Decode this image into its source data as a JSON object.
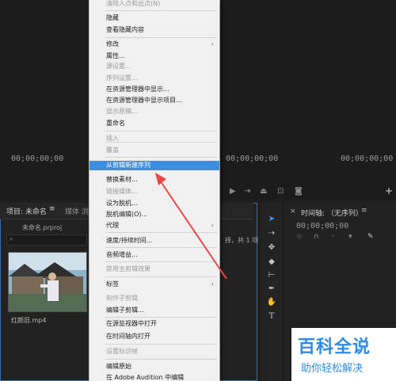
{
  "source_monitor": {
    "timecode": "00;00;00;00"
  },
  "program_monitor": {
    "timecode_left": "00;00;00;00",
    "timecode_right": "00;00;00;00"
  },
  "project_panel": {
    "tab_title": "项目: 未命名",
    "tab_menu": "≡",
    "tab2": "媒体 浏",
    "project_file": "未命名.prproj",
    "clip_name": "红颜旧.mp4",
    "item_count": "择，共 1 项"
  },
  "timeline_panel": {
    "title": "时间轴: （无序列）",
    "menu": "≡",
    "timecode": "00;00;00;00"
  },
  "context_menu": {
    "items": [
      {
        "label": "清除入点和出点(N)",
        "disabled": true
      },
      {
        "label": "隐藏",
        "disabled": false
      },
      {
        "label": "查看隐藏内容",
        "disabled": false
      },
      {
        "label": "修改",
        "disabled": false,
        "submenu": true
      },
      {
        "label": "属性...",
        "disabled": false
      },
      {
        "label": "源设置...",
        "disabled": true
      },
      {
        "label": "序列设置...",
        "disabled": true
      },
      {
        "label": "在资源管理器中显示...",
        "disabled": false
      },
      {
        "label": "在资源管理器中显示项目...",
        "disabled": false
      },
      {
        "label": "显示原稿...",
        "disabled": true
      },
      {
        "label": "重命名",
        "disabled": false
      },
      {
        "label": "插入",
        "disabled": true
      },
      {
        "label": "覆盖",
        "disabled": true
      },
      {
        "label": "从剪辑新建序列",
        "disabled": false,
        "highlighted": true
      },
      {
        "label": "替换素材...",
        "disabled": false
      },
      {
        "label": "链接媒体...",
        "disabled": true
      },
      {
        "label": "设为脱机...",
        "disabled": false
      },
      {
        "label": "脱机编辑(O)...",
        "disabled": false
      },
      {
        "label": "代理",
        "disabled": false,
        "submenu": true
      },
      {
        "label": "速度/持续时间...",
        "disabled": false
      },
      {
        "label": "音频增益...",
        "disabled": false
      },
      {
        "label": "禁用主剪辑效果",
        "disabled": true
      },
      {
        "label": "标签",
        "disabled": false,
        "submenu": true
      },
      {
        "label": "制作子剪辑",
        "disabled": true
      },
      {
        "label": "编辑子剪辑...",
        "disabled": false
      },
      {
        "label": "在源监视器中打开",
        "disabled": false
      },
      {
        "label": "在时间轴内打开",
        "disabled": false
      },
      {
        "label": "设置标识帧",
        "disabled": true
      },
      {
        "label": "编辑原始",
        "disabled": false
      },
      {
        "label": "在 Adobe Audition 中编辑",
        "disabled": false
      }
    ]
  },
  "watermark": {
    "title": "百科全说",
    "subtitle": "助你轻松解决"
  },
  "colors": {
    "highlight": "#3e8ee0",
    "arrow": "#e84848",
    "accent_blue": "#2d8ceb"
  }
}
